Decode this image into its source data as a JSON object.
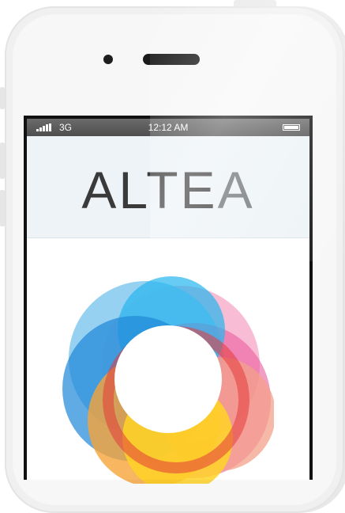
{
  "statusbar": {
    "network": "3G",
    "time": "12:12 AM"
  },
  "header": {
    "logo_main": "ALTE",
    "logo_last": "A"
  },
  "icons": {
    "signal": "signal-bars-icon",
    "battery": "battery-icon",
    "logo_ring": "rainbow-ring-logo"
  },
  "colors": {
    "blue": "#1e88d8",
    "cyan": "#27b6ee",
    "pink": "#ea5c9c",
    "orange": "#f4a63a",
    "yellow": "#ffd426",
    "red": "#e43b3b"
  }
}
